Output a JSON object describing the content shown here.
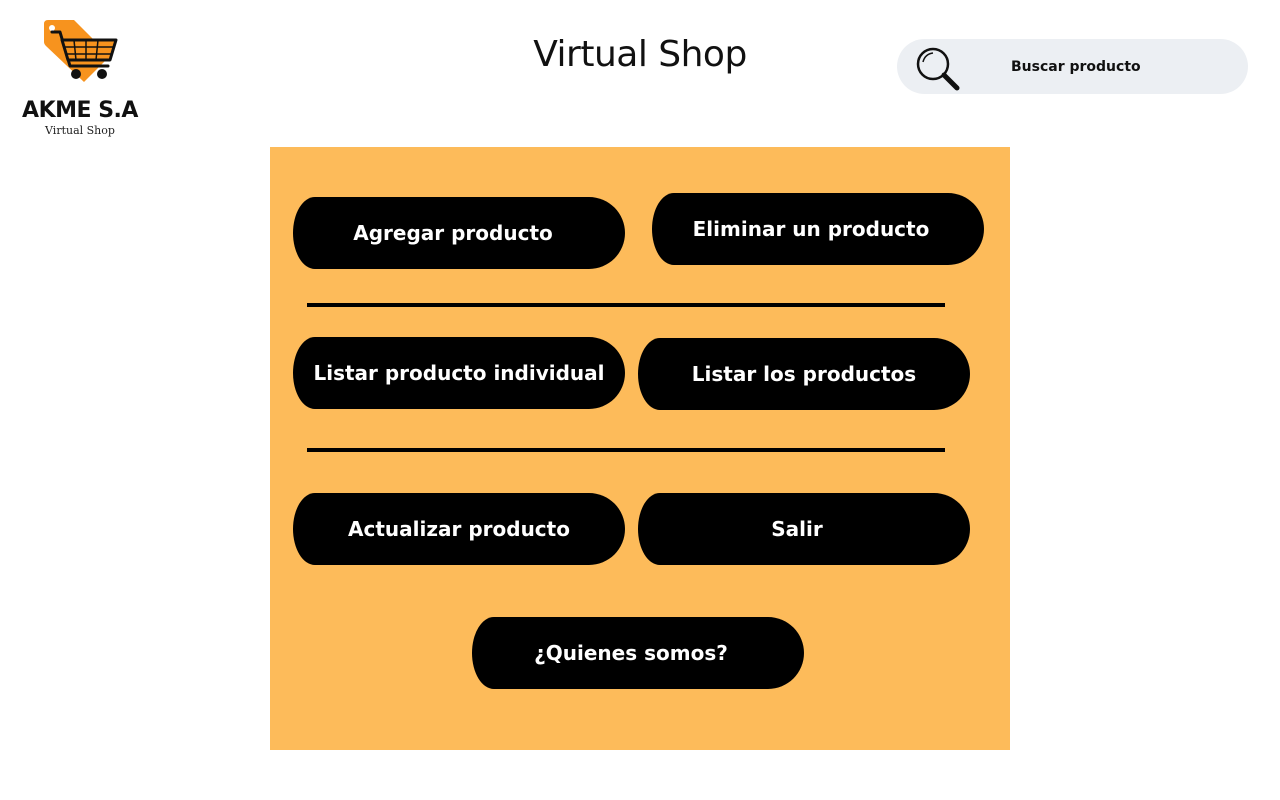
{
  "header": {
    "logo": {
      "name": "AKME S.A",
      "tagline": "Virtual Shop",
      "icon": "shopping-cart-tag-icon",
      "colors": {
        "tag": "#f7931e",
        "cart": "#111111"
      }
    },
    "title": "Virtual Shop",
    "search": {
      "icon": "search-icon",
      "placeholder": "Buscar producto"
    }
  },
  "menu": {
    "background": "#fdbb5a",
    "buttons": {
      "add": "Agregar producto",
      "delete": "Eliminar un producto",
      "list_one": "Listar producto individual",
      "list_all": "Listar los productos",
      "update": "Actualizar producto",
      "exit": "Salir",
      "about": "¿Quienes somos?"
    }
  }
}
